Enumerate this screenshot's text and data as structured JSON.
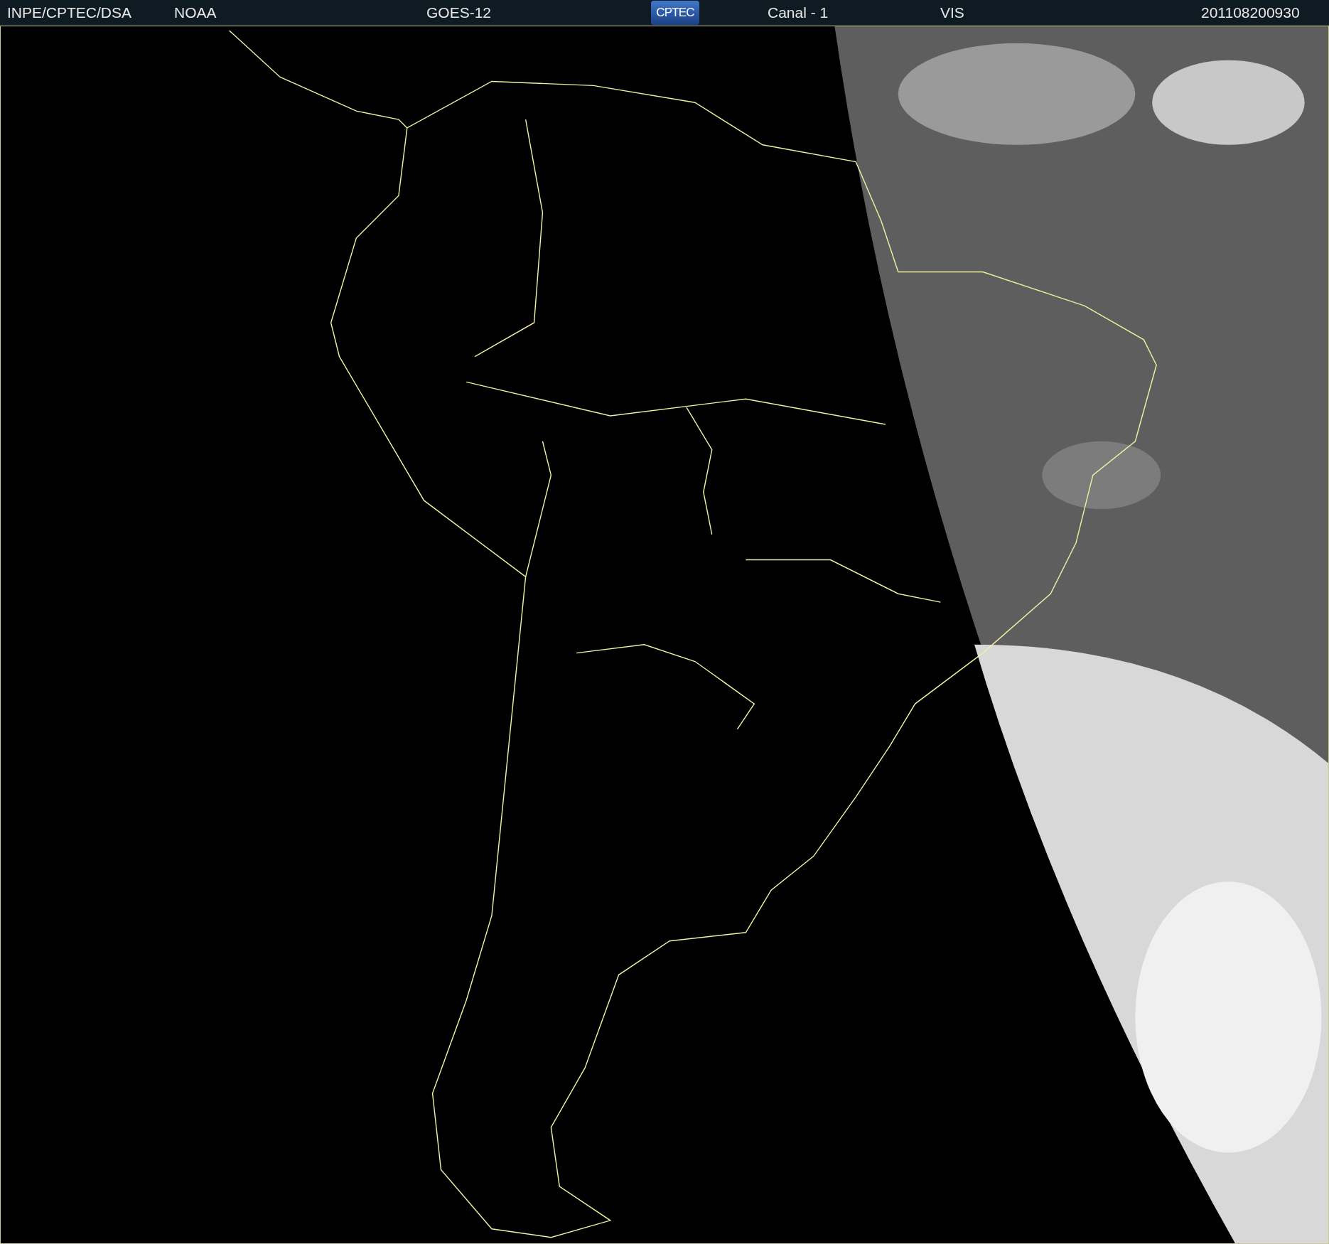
{
  "header": {
    "source": "INPE/CPTEC/DSA",
    "agency": "NOAA",
    "satellite": "GOES-12",
    "logo": "CPTEC",
    "channel": "Canal - 1",
    "band": "VIS",
    "timestamp": "201108200930"
  }
}
